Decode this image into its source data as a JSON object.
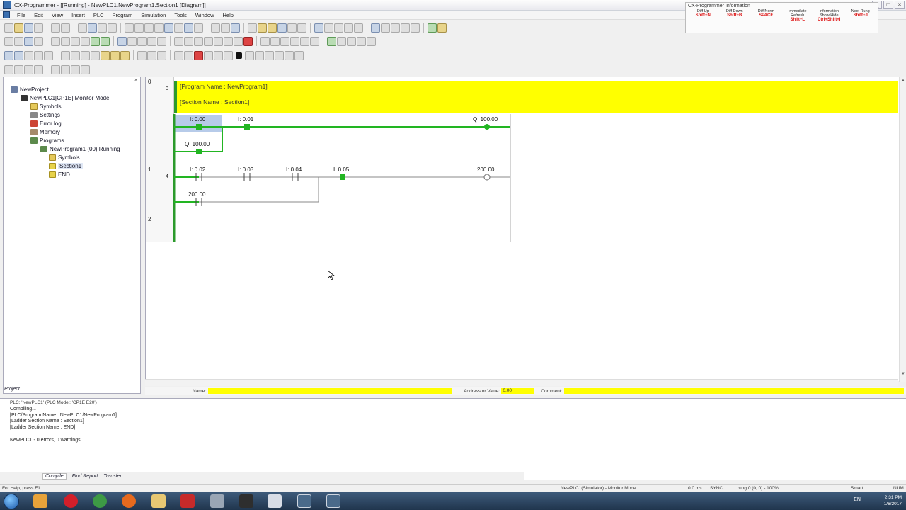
{
  "window": {
    "title": "CX-Programmer - [[Running] - NewPLC1.NewProgram1.Section1 [Diagram]]",
    "controls": [
      "_",
      "□",
      "×"
    ]
  },
  "menu": [
    "File",
    "Edit",
    "View",
    "Insert",
    "PLC",
    "Program",
    "Simulation",
    "Tools",
    "Window",
    "Help"
  ],
  "info_panel": {
    "title": "CX-Programmer Information",
    "cells": [
      {
        "label": "Diff Up",
        "key": "Shift+N"
      },
      {
        "label": "Diff Down",
        "key": "Shift+B"
      },
      {
        "label": "Diff Norm",
        "key": "SPACE"
      },
      {
        "label": "Immediate Refresh",
        "key": "Shift+L"
      },
      {
        "label": "Information Show Hide",
        "key": "Ctrl+Shift+I"
      },
      {
        "label": "Next Rung",
        "key": "Shift+J"
      }
    ]
  },
  "tree": {
    "items": [
      {
        "label": "NewProject",
        "indent": 0,
        "glyph": "g-root"
      },
      {
        "label": "NewPLC1[CP1E] Monitor Mode",
        "indent": 1,
        "glyph": "g-plc"
      },
      {
        "label": "Symbols",
        "indent": 2,
        "glyph": "g-sym"
      },
      {
        "label": "Settings",
        "indent": 2,
        "glyph": "g-set"
      },
      {
        "label": "Error log",
        "indent": 2,
        "glyph": "g-err"
      },
      {
        "label": "Memory",
        "indent": 2,
        "glyph": "g-mem"
      },
      {
        "label": "Programs",
        "indent": 2,
        "glyph": "g-prog"
      },
      {
        "label": "NewProgram1 (00) Running",
        "indent": 3,
        "glyph": "g-prog"
      },
      {
        "label": "Symbols",
        "indent": 4,
        "glyph": "g-sym"
      },
      {
        "label": "Section1",
        "indent": 4,
        "glyph": "g-sec"
      },
      {
        "label": "END",
        "indent": 4,
        "glyph": "g-sec"
      }
    ],
    "tab": "Project"
  },
  "ladder": {
    "header": {
      "program": "[Program Name : NewProgram1]",
      "section": "[Section Name : Section1]"
    },
    "rungs": [
      {
        "number": "0",
        "step": "0"
      },
      {
        "number": "1",
        "step": "4"
      },
      {
        "number": "2",
        "step": ""
      }
    ],
    "contacts": {
      "c1": "I: 0.00",
      "c2": "I: 0.01",
      "c3": "Q: 100.00",
      "c4": "Q: 100.00",
      "c5": "I: 0.02",
      "c6": "I: 0.03",
      "c7": "I: 0.04",
      "c8": "I: 0.05",
      "c9": "200.00",
      "c10": "200.00"
    }
  },
  "namebar": {
    "name_label": "Name:",
    "name_value": "",
    "address_label": "Address or Value:",
    "address_value": "0.00",
    "comment_label": "Comment:",
    "comment_value": ""
  },
  "output": {
    "header": "PLC: 'NewPLC1' (PLC Model: 'CP1E E20')",
    "lines": [
      "Compiling...",
      "[PLC/Program Name : NewPLC1/NewProgram1]",
      "[Ladder Section Name : Section1]",
      "[Ladder Section Name : END]",
      "",
      "NewPLC1 - 0 errors, 0 warnings."
    ],
    "tabs": [
      "Compile",
      "Find Report",
      "Transfer"
    ]
  },
  "status": {
    "help": "For Help, press F1",
    "mode": "NewPLC1(Simulator) - Monitor Mode",
    "cycle": "0.0 ms",
    "sync": "SYNC",
    "rung": "rung 0 (0, 0) - 100%",
    "smart": "Smart",
    "num": "NUM"
  },
  "taskbar": {
    "time": "2:31 PM",
    "date": "1/6/2017",
    "lang": "EN"
  },
  "colors": {
    "active_green": "#22b522",
    "header_yellow": "#ffff00",
    "rail_green": "#2b9a2b"
  }
}
